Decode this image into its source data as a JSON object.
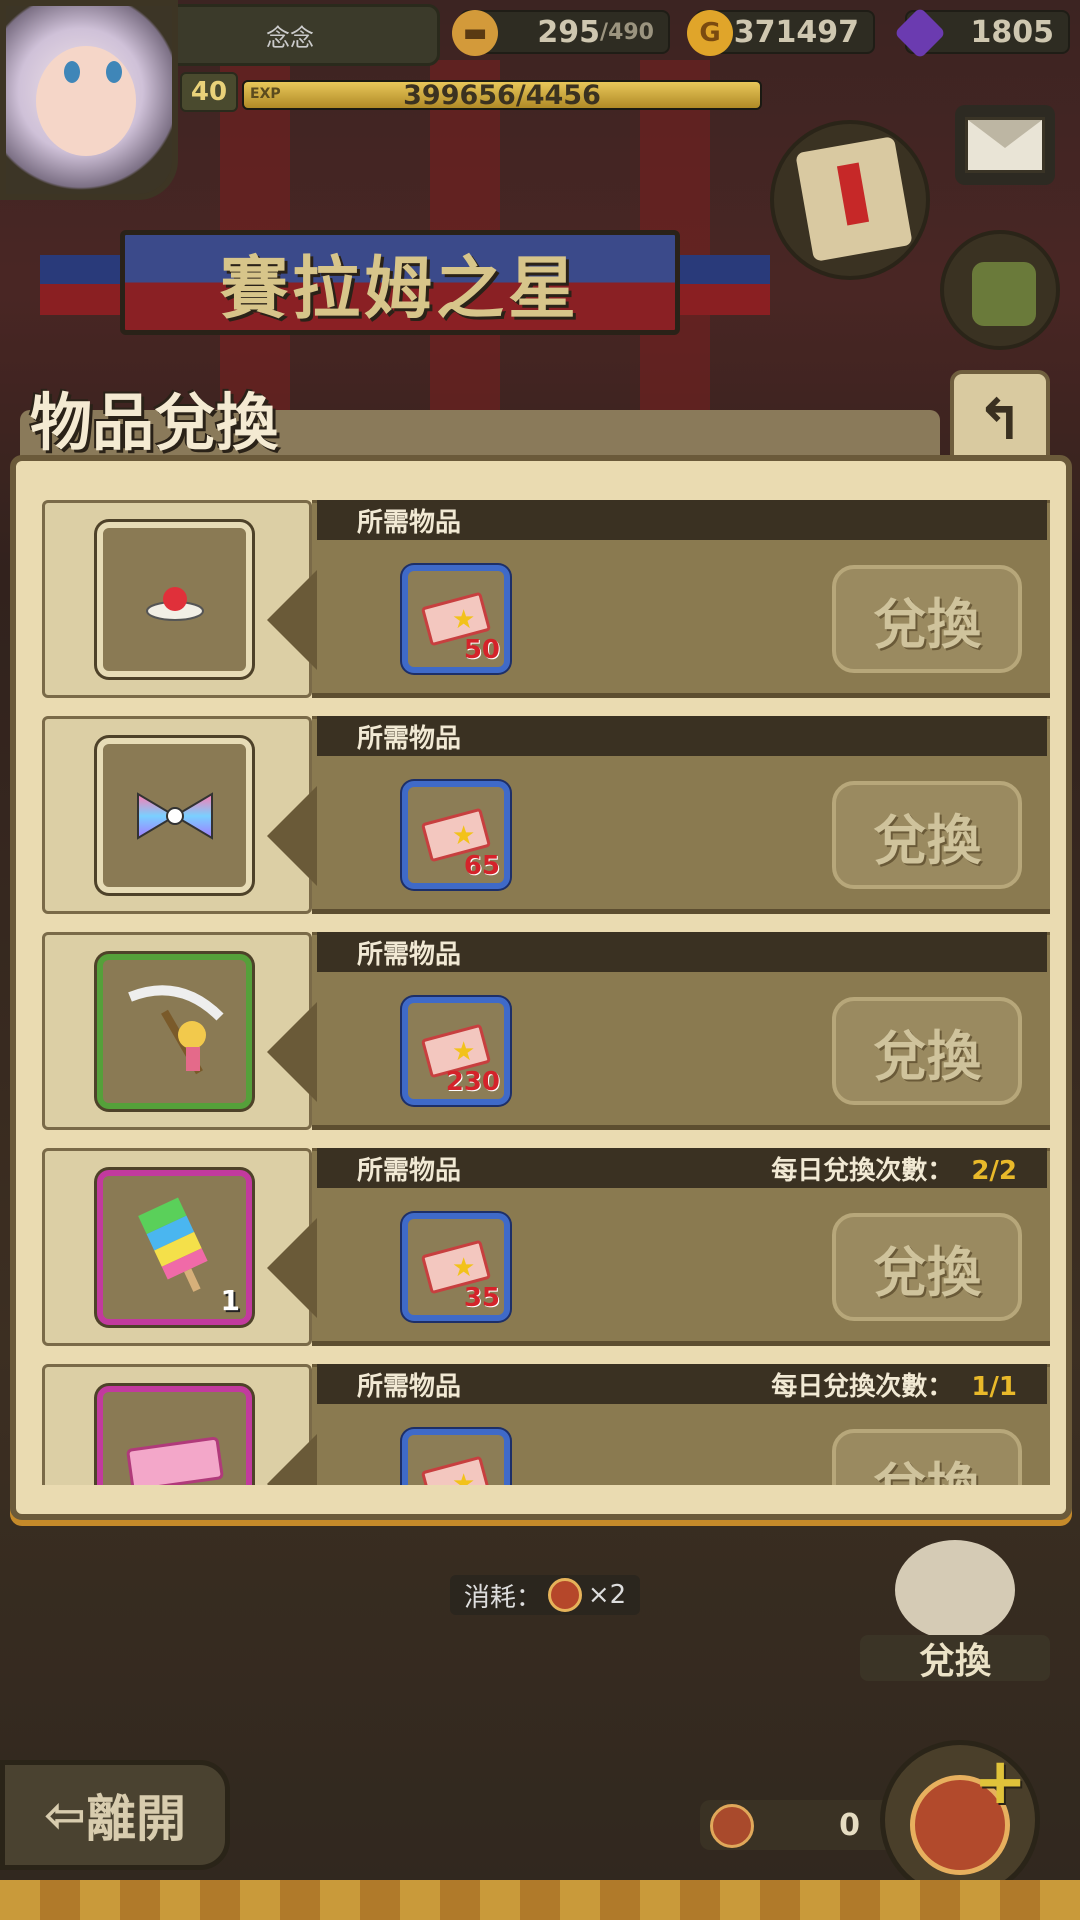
{
  "header": {
    "player_name": "念念",
    "level": "40",
    "exp_label": "EXP",
    "exp_text": "399656/4456",
    "exp_progress": 1.0,
    "resources": [
      {
        "name": "stamina",
        "icon": "bread-icon",
        "value": "295",
        "max": "/490"
      },
      {
        "name": "gold",
        "icon": "gold-coin-icon",
        "value": "371497"
      },
      {
        "name": "gems",
        "icon": "purple-gem-icon",
        "value": "1805"
      }
    ]
  },
  "banner": {
    "title": "賽拉姆之星"
  },
  "panel": {
    "title": "物品兌換",
    "back_icon": "return-arrow-icon"
  },
  "rows": [
    {
      "header": "所需物品",
      "daily_label": "",
      "daily_value": "",
      "item_icon": "red-gem-ring-icon",
      "item_qty": "",
      "ticket_cost": "50",
      "button": "兌換",
      "frame": "plain"
    },
    {
      "header": "所需物品",
      "daily_label": "",
      "daily_value": "",
      "item_icon": "rainbow-bow-icon",
      "item_qty": "",
      "ticket_cost": "65",
      "button": "兌換",
      "frame": "plain"
    },
    {
      "header": "所需物品",
      "daily_label": "",
      "daily_value": "",
      "item_icon": "bunny-scythe-icon",
      "item_qty": "",
      "ticket_cost": "230",
      "button": "兌換",
      "frame": "green"
    },
    {
      "header": "所需物品",
      "daily_label": "每日兌換次數：",
      "daily_value": "2/2",
      "item_icon": "rainbow-popsicle-icon",
      "item_qty": "1",
      "ticket_cost": "35",
      "button": "兌換",
      "frame": "purple"
    },
    {
      "header": "所需物品",
      "daily_label": "每日兌換次數：",
      "daily_value": "1/1",
      "item_icon": "pink-ticket-icon",
      "item_qty": "",
      "ticket_cost": "",
      "button": "兌換",
      "frame": "purple"
    }
  ],
  "bottom": {
    "consume_label": "消耗：",
    "consume_qty": "×2",
    "exchange_label": "兌換",
    "leave_label": "離開",
    "coin_count": "0"
  },
  "colors": {
    "ticket_border": "#3f6ac8",
    "cost_red": "#d4232a",
    "daily_yellow": "#e9b92a",
    "panel_bg": "#eadbb1"
  }
}
